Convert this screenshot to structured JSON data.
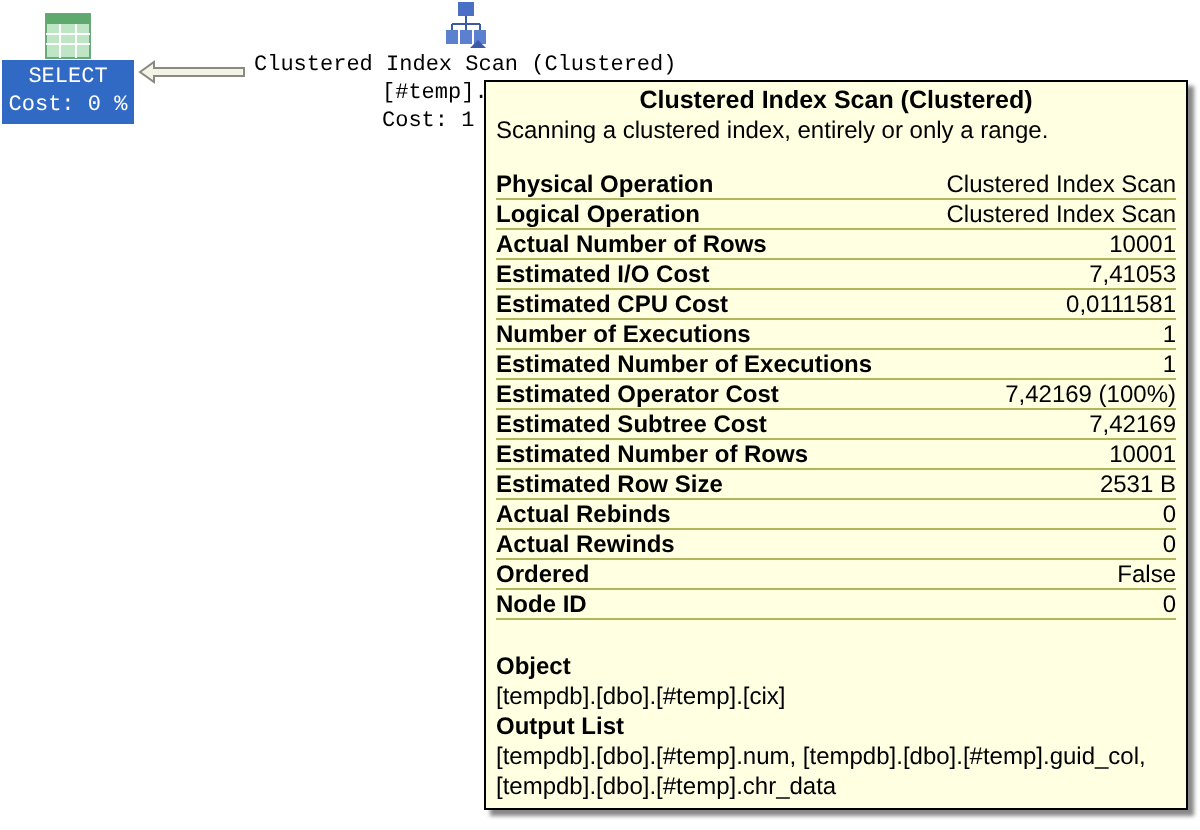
{
  "nodes": [
    {
      "kind": "select",
      "selected": true,
      "lines": [
        "SELECT",
        "Cost: 0 %"
      ]
    },
    {
      "kind": "scan",
      "selected": false,
      "lines": [
        "Clustered Index Scan (Clustered)",
        "[#temp].",
        "Cost: 1"
      ]
    }
  ],
  "tooltip": {
    "title": "Clustered Index Scan (Clustered)",
    "description": "Scanning a clustered index, entirely or only a range.",
    "properties": [
      {
        "name": "Physical Operation",
        "value": "Clustered Index Scan"
      },
      {
        "name": "Logical Operation",
        "value": "Clustered Index Scan"
      },
      {
        "name": "Actual Number of Rows",
        "value": "10001"
      },
      {
        "name": "Estimated I/O Cost",
        "value": "7,41053"
      },
      {
        "name": "Estimated CPU Cost",
        "value": "0,0111581"
      },
      {
        "name": "Number of Executions",
        "value": "1"
      },
      {
        "name": "Estimated Number of Executions",
        "value": "1"
      },
      {
        "name": "Estimated Operator Cost",
        "value": "7,42169 (100%)"
      },
      {
        "name": "Estimated Subtree Cost",
        "value": "7,42169"
      },
      {
        "name": "Estimated Number of Rows",
        "value": "10001"
      },
      {
        "name": "Estimated Row Size",
        "value": "2531 B"
      },
      {
        "name": "Actual Rebinds",
        "value": "0"
      },
      {
        "name": "Actual Rewinds",
        "value": "0"
      },
      {
        "name": "Ordered",
        "value": "False"
      },
      {
        "name": "Node ID",
        "value": "0"
      }
    ],
    "sections": [
      {
        "heading": "Object",
        "text": "[tempdb].[dbo].[#temp].[cix]"
      },
      {
        "heading": "Output List",
        "text": "[tempdb].[dbo].[#temp].num,  [tempdb].[dbo].[#temp].guid_col,  [tempdb].[dbo].[#temp].chr_data"
      }
    ]
  }
}
